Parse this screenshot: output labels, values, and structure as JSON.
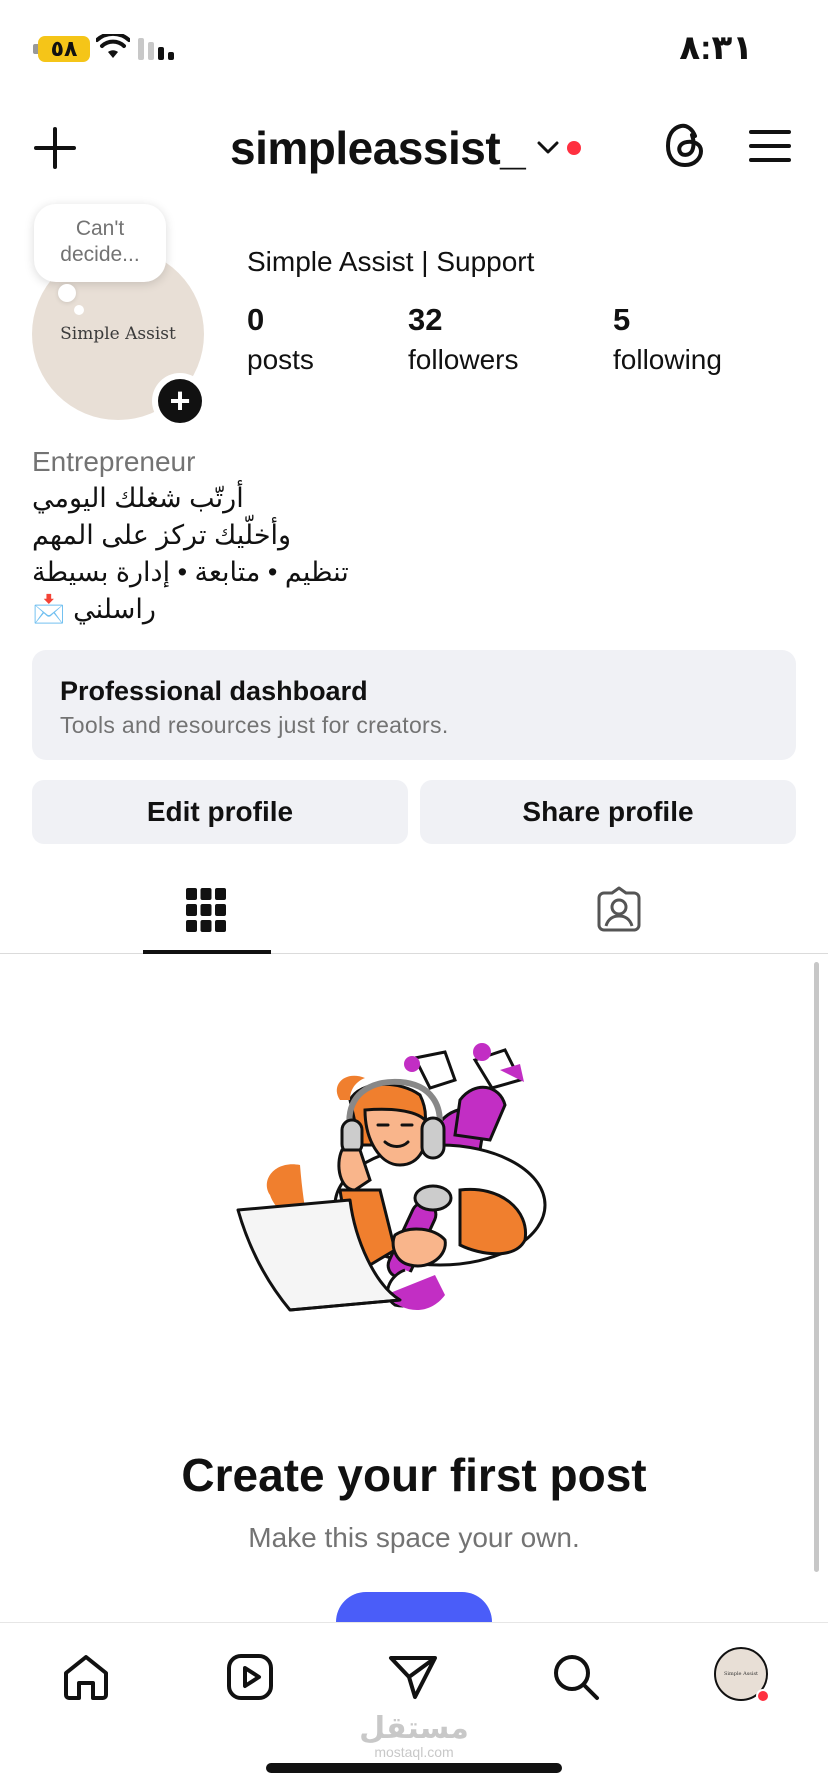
{
  "status_bar": {
    "battery_level": "٥٨",
    "time": "٨:٣١"
  },
  "header": {
    "username": "simpleassist_",
    "has_notification": true
  },
  "profile": {
    "note_text": "Can't decide...",
    "avatar_text": "Simple Assist",
    "display_name": "Simple Assist | Support",
    "stats": [
      {
        "value": "0",
        "label": "posts"
      },
      {
        "value": "32",
        "label": "followers"
      },
      {
        "value": "5",
        "label": "following"
      }
    ],
    "category": "Entrepreneur",
    "bio_lines": [
      "أرتّب شغلك اليومي",
      "وأخلّيك تركز على المهم",
      "تنظيم • متابعة • إدارة بسيطة",
      "راسلني 📩"
    ]
  },
  "professional_dashboard": {
    "title": "Professional dashboard",
    "subtitle": "Tools and resources just for creators."
  },
  "actions": {
    "edit_profile": "Edit profile",
    "share_profile": "Share profile"
  },
  "tabs": {
    "selected": "posts-grid",
    "items": [
      "grid-icon",
      "tagged-icon"
    ]
  },
  "empty_state": {
    "title": "Create your first post",
    "subtitle": "Make this space your own."
  },
  "bottom_nav": {
    "items": [
      "home-icon",
      "reels-icon",
      "messages-icon",
      "search-icon",
      "profile-avatar"
    ],
    "avatar_text": "Simple Assist"
  },
  "watermark": {
    "arabic": "مستقل",
    "latin": "mostaql.com"
  },
  "colors": {
    "accent_blue": "#4a5df9",
    "notification_red": "#ff3040",
    "battery_yellow": "#f5c518",
    "surface_gray": "#f0f1f5",
    "illustration_orange": "#f07f2e",
    "illustration_magenta": "#c22ec4"
  }
}
